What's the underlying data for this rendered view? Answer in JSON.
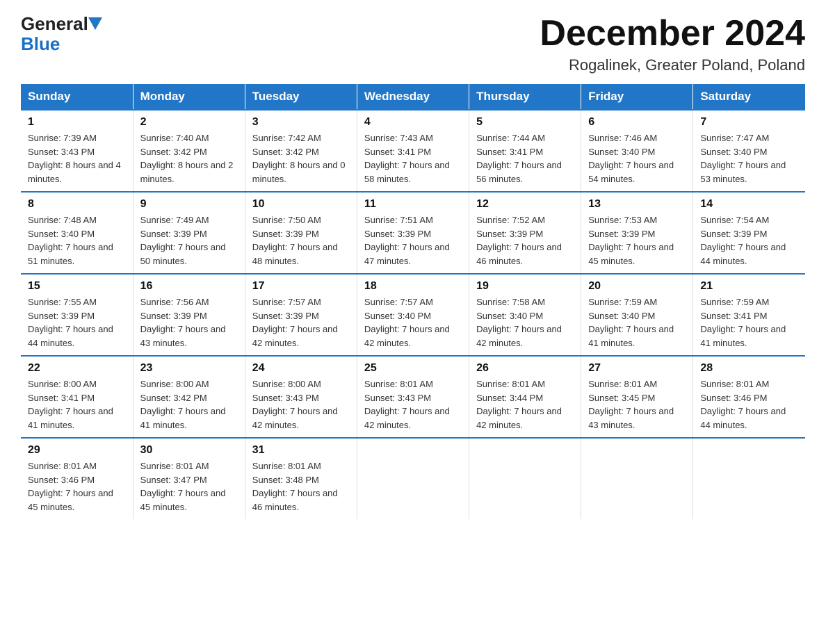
{
  "logo": {
    "general": "General",
    "blue": "Blue"
  },
  "title": "December 2024",
  "subtitle": "Rogalinek, Greater Poland, Poland",
  "days_of_week": [
    "Sunday",
    "Monday",
    "Tuesday",
    "Wednesday",
    "Thursday",
    "Friday",
    "Saturday"
  ],
  "weeks": [
    [
      {
        "day": "1",
        "sunrise": "7:39 AM",
        "sunset": "3:43 PM",
        "daylight": "8 hours and 4 minutes."
      },
      {
        "day": "2",
        "sunrise": "7:40 AM",
        "sunset": "3:42 PM",
        "daylight": "8 hours and 2 minutes."
      },
      {
        "day": "3",
        "sunrise": "7:42 AM",
        "sunset": "3:42 PM",
        "daylight": "8 hours and 0 minutes."
      },
      {
        "day": "4",
        "sunrise": "7:43 AM",
        "sunset": "3:41 PM",
        "daylight": "7 hours and 58 minutes."
      },
      {
        "day": "5",
        "sunrise": "7:44 AM",
        "sunset": "3:41 PM",
        "daylight": "7 hours and 56 minutes."
      },
      {
        "day": "6",
        "sunrise": "7:46 AM",
        "sunset": "3:40 PM",
        "daylight": "7 hours and 54 minutes."
      },
      {
        "day": "7",
        "sunrise": "7:47 AM",
        "sunset": "3:40 PM",
        "daylight": "7 hours and 53 minutes."
      }
    ],
    [
      {
        "day": "8",
        "sunrise": "7:48 AM",
        "sunset": "3:40 PM",
        "daylight": "7 hours and 51 minutes."
      },
      {
        "day": "9",
        "sunrise": "7:49 AM",
        "sunset": "3:39 PM",
        "daylight": "7 hours and 50 minutes."
      },
      {
        "day": "10",
        "sunrise": "7:50 AM",
        "sunset": "3:39 PM",
        "daylight": "7 hours and 48 minutes."
      },
      {
        "day": "11",
        "sunrise": "7:51 AM",
        "sunset": "3:39 PM",
        "daylight": "7 hours and 47 minutes."
      },
      {
        "day": "12",
        "sunrise": "7:52 AM",
        "sunset": "3:39 PM",
        "daylight": "7 hours and 46 minutes."
      },
      {
        "day": "13",
        "sunrise": "7:53 AM",
        "sunset": "3:39 PM",
        "daylight": "7 hours and 45 minutes."
      },
      {
        "day": "14",
        "sunrise": "7:54 AM",
        "sunset": "3:39 PM",
        "daylight": "7 hours and 44 minutes."
      }
    ],
    [
      {
        "day": "15",
        "sunrise": "7:55 AM",
        "sunset": "3:39 PM",
        "daylight": "7 hours and 44 minutes."
      },
      {
        "day": "16",
        "sunrise": "7:56 AM",
        "sunset": "3:39 PM",
        "daylight": "7 hours and 43 minutes."
      },
      {
        "day": "17",
        "sunrise": "7:57 AM",
        "sunset": "3:39 PM",
        "daylight": "7 hours and 42 minutes."
      },
      {
        "day": "18",
        "sunrise": "7:57 AM",
        "sunset": "3:40 PM",
        "daylight": "7 hours and 42 minutes."
      },
      {
        "day": "19",
        "sunrise": "7:58 AM",
        "sunset": "3:40 PM",
        "daylight": "7 hours and 42 minutes."
      },
      {
        "day": "20",
        "sunrise": "7:59 AM",
        "sunset": "3:40 PM",
        "daylight": "7 hours and 41 minutes."
      },
      {
        "day": "21",
        "sunrise": "7:59 AM",
        "sunset": "3:41 PM",
        "daylight": "7 hours and 41 minutes."
      }
    ],
    [
      {
        "day": "22",
        "sunrise": "8:00 AM",
        "sunset": "3:41 PM",
        "daylight": "7 hours and 41 minutes."
      },
      {
        "day": "23",
        "sunrise": "8:00 AM",
        "sunset": "3:42 PM",
        "daylight": "7 hours and 41 minutes."
      },
      {
        "day": "24",
        "sunrise": "8:00 AM",
        "sunset": "3:43 PM",
        "daylight": "7 hours and 42 minutes."
      },
      {
        "day": "25",
        "sunrise": "8:01 AM",
        "sunset": "3:43 PM",
        "daylight": "7 hours and 42 minutes."
      },
      {
        "day": "26",
        "sunrise": "8:01 AM",
        "sunset": "3:44 PM",
        "daylight": "7 hours and 42 minutes."
      },
      {
        "day": "27",
        "sunrise": "8:01 AM",
        "sunset": "3:45 PM",
        "daylight": "7 hours and 43 minutes."
      },
      {
        "day": "28",
        "sunrise": "8:01 AM",
        "sunset": "3:46 PM",
        "daylight": "7 hours and 44 minutes."
      }
    ],
    [
      {
        "day": "29",
        "sunrise": "8:01 AM",
        "sunset": "3:46 PM",
        "daylight": "7 hours and 45 minutes."
      },
      {
        "day": "30",
        "sunrise": "8:01 AM",
        "sunset": "3:47 PM",
        "daylight": "7 hours and 45 minutes."
      },
      {
        "day": "31",
        "sunrise": "8:01 AM",
        "sunset": "3:48 PM",
        "daylight": "7 hours and 46 minutes."
      },
      null,
      null,
      null,
      null
    ]
  ]
}
